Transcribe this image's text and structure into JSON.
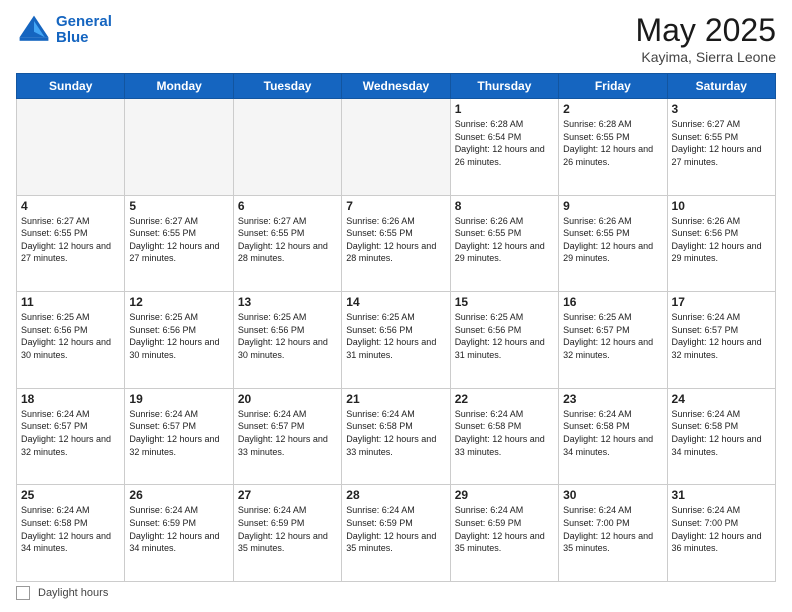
{
  "header": {
    "logo_line1": "General",
    "logo_line2": "Blue",
    "month": "May 2025",
    "location": "Kayima, Sierra Leone"
  },
  "weekdays": [
    "Sunday",
    "Monday",
    "Tuesday",
    "Wednesday",
    "Thursday",
    "Friday",
    "Saturday"
  ],
  "footer": {
    "label": "Daylight hours"
  },
  "weeks": [
    [
      {
        "day": "",
        "info": ""
      },
      {
        "day": "",
        "info": ""
      },
      {
        "day": "",
        "info": ""
      },
      {
        "day": "",
        "info": ""
      },
      {
        "day": "1",
        "info": "Sunrise: 6:28 AM\nSunset: 6:54 PM\nDaylight: 12 hours\nand 26 minutes."
      },
      {
        "day": "2",
        "info": "Sunrise: 6:28 AM\nSunset: 6:55 PM\nDaylight: 12 hours\nand 26 minutes."
      },
      {
        "day": "3",
        "info": "Sunrise: 6:27 AM\nSunset: 6:55 PM\nDaylight: 12 hours\nand 27 minutes."
      }
    ],
    [
      {
        "day": "4",
        "info": "Sunrise: 6:27 AM\nSunset: 6:55 PM\nDaylight: 12 hours\nand 27 minutes."
      },
      {
        "day": "5",
        "info": "Sunrise: 6:27 AM\nSunset: 6:55 PM\nDaylight: 12 hours\nand 27 minutes."
      },
      {
        "day": "6",
        "info": "Sunrise: 6:27 AM\nSunset: 6:55 PM\nDaylight: 12 hours\nand 28 minutes."
      },
      {
        "day": "7",
        "info": "Sunrise: 6:26 AM\nSunset: 6:55 PM\nDaylight: 12 hours\nand 28 minutes."
      },
      {
        "day": "8",
        "info": "Sunrise: 6:26 AM\nSunset: 6:55 PM\nDaylight: 12 hours\nand 29 minutes."
      },
      {
        "day": "9",
        "info": "Sunrise: 6:26 AM\nSunset: 6:55 PM\nDaylight: 12 hours\nand 29 minutes."
      },
      {
        "day": "10",
        "info": "Sunrise: 6:26 AM\nSunset: 6:56 PM\nDaylight: 12 hours\nand 29 minutes."
      }
    ],
    [
      {
        "day": "11",
        "info": "Sunrise: 6:25 AM\nSunset: 6:56 PM\nDaylight: 12 hours\nand 30 minutes."
      },
      {
        "day": "12",
        "info": "Sunrise: 6:25 AM\nSunset: 6:56 PM\nDaylight: 12 hours\nand 30 minutes."
      },
      {
        "day": "13",
        "info": "Sunrise: 6:25 AM\nSunset: 6:56 PM\nDaylight: 12 hours\nand 30 minutes."
      },
      {
        "day": "14",
        "info": "Sunrise: 6:25 AM\nSunset: 6:56 PM\nDaylight: 12 hours\nand 31 minutes."
      },
      {
        "day": "15",
        "info": "Sunrise: 6:25 AM\nSunset: 6:56 PM\nDaylight: 12 hours\nand 31 minutes."
      },
      {
        "day": "16",
        "info": "Sunrise: 6:25 AM\nSunset: 6:57 PM\nDaylight: 12 hours\nand 32 minutes."
      },
      {
        "day": "17",
        "info": "Sunrise: 6:24 AM\nSunset: 6:57 PM\nDaylight: 12 hours\nand 32 minutes."
      }
    ],
    [
      {
        "day": "18",
        "info": "Sunrise: 6:24 AM\nSunset: 6:57 PM\nDaylight: 12 hours\nand 32 minutes."
      },
      {
        "day": "19",
        "info": "Sunrise: 6:24 AM\nSunset: 6:57 PM\nDaylight: 12 hours\nand 32 minutes."
      },
      {
        "day": "20",
        "info": "Sunrise: 6:24 AM\nSunset: 6:57 PM\nDaylight: 12 hours\nand 33 minutes."
      },
      {
        "day": "21",
        "info": "Sunrise: 6:24 AM\nSunset: 6:58 PM\nDaylight: 12 hours\nand 33 minutes."
      },
      {
        "day": "22",
        "info": "Sunrise: 6:24 AM\nSunset: 6:58 PM\nDaylight: 12 hours\nand 33 minutes."
      },
      {
        "day": "23",
        "info": "Sunrise: 6:24 AM\nSunset: 6:58 PM\nDaylight: 12 hours\nand 34 minutes."
      },
      {
        "day": "24",
        "info": "Sunrise: 6:24 AM\nSunset: 6:58 PM\nDaylight: 12 hours\nand 34 minutes."
      }
    ],
    [
      {
        "day": "25",
        "info": "Sunrise: 6:24 AM\nSunset: 6:58 PM\nDaylight: 12 hours\nand 34 minutes."
      },
      {
        "day": "26",
        "info": "Sunrise: 6:24 AM\nSunset: 6:59 PM\nDaylight: 12 hours\nand 34 minutes."
      },
      {
        "day": "27",
        "info": "Sunrise: 6:24 AM\nSunset: 6:59 PM\nDaylight: 12 hours\nand 35 minutes."
      },
      {
        "day": "28",
        "info": "Sunrise: 6:24 AM\nSunset: 6:59 PM\nDaylight: 12 hours\nand 35 minutes."
      },
      {
        "day": "29",
        "info": "Sunrise: 6:24 AM\nSunset: 6:59 PM\nDaylight: 12 hours\nand 35 minutes."
      },
      {
        "day": "30",
        "info": "Sunrise: 6:24 AM\nSunset: 7:00 PM\nDaylight: 12 hours\nand 35 minutes."
      },
      {
        "day": "31",
        "info": "Sunrise: 6:24 AM\nSunset: 7:00 PM\nDaylight: 12 hours\nand 36 minutes."
      }
    ]
  ]
}
